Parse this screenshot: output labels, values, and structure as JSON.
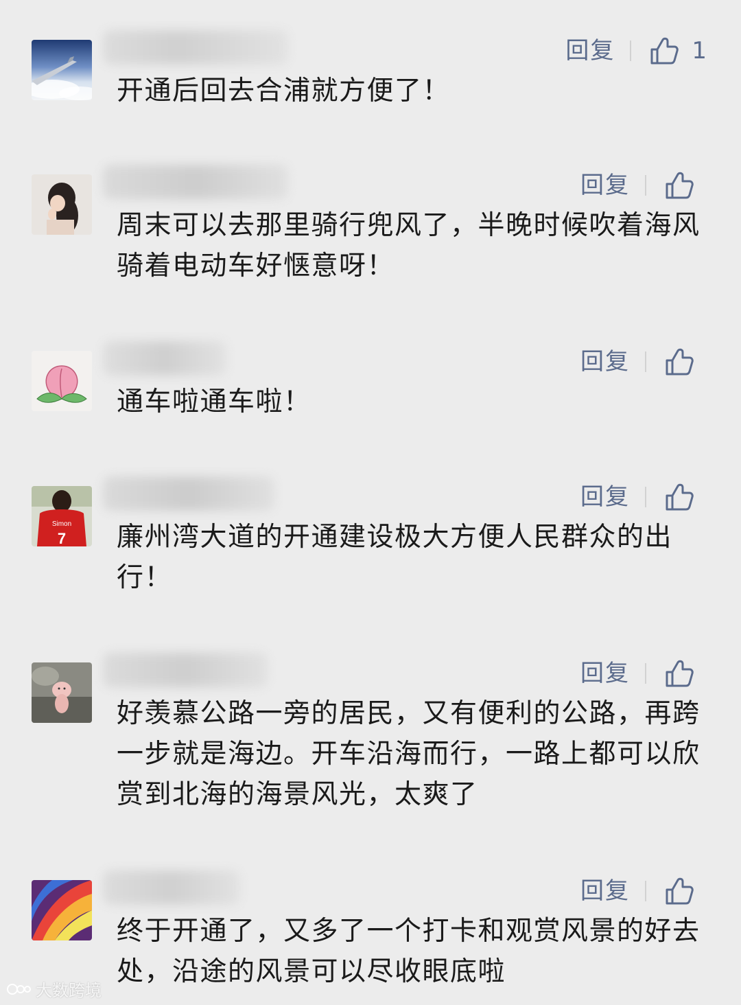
{
  "reply_label": "回复",
  "comments": [
    {
      "text": "开通后回去合浦就方便了！",
      "likes": "1",
      "avatar": "airplane-wing-sky"
    },
    {
      "text": "周末可以去那里骑行兜风了，半晚时候吹着海风骑着电动车好惬意呀！",
      "likes": "",
      "avatar": "girl-portrait"
    },
    {
      "text": "通车啦通车啦！",
      "likes": "",
      "avatar": "peach-drawing"
    },
    {
      "text": "廉州湾大道的开通建设极大方便人民群众的出行！",
      "likes": "",
      "avatar": "boy-red-jersey"
    },
    {
      "text": "好羡慕公路一旁的居民，又有便利的公路，再跨一步就是海边。开车沿海而行，一路上都可以欣赏到北海的海景风光，太爽了",
      "likes": "",
      "avatar": "piglet"
    },
    {
      "text": "终于开通了，又多了一个打卡和观赏风景的好去处，沿途的风景可以尽收眼底啦",
      "likes": "",
      "avatar": "colorful-feathers"
    }
  ],
  "watermark": {
    "text": "大数跨境"
  },
  "colors": {
    "background": "#ececec",
    "action": "#5b6b8c",
    "text": "#1a1a1a"
  }
}
